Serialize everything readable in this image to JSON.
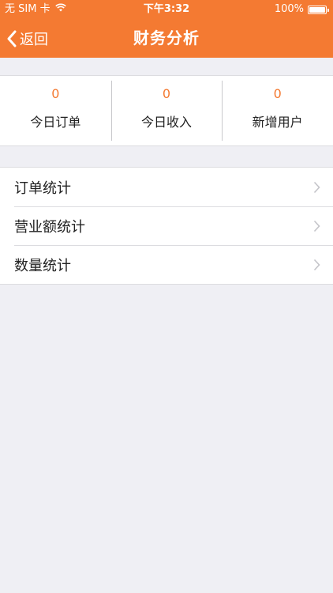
{
  "status_bar": {
    "carrier": "无 SIM 卡",
    "time": "下午3:32",
    "battery": "100%"
  },
  "nav": {
    "back_label": "返回",
    "title": "财务分析"
  },
  "stats": [
    {
      "value": "0",
      "label": "今日订单"
    },
    {
      "value": "0",
      "label": "今日收入"
    },
    {
      "value": "0",
      "label": "新增用户"
    }
  ],
  "menu": [
    {
      "label": "订单统计"
    },
    {
      "label": "营业额统计"
    },
    {
      "label": "数量统计"
    }
  ],
  "colors": {
    "accent": "#f47a32",
    "background": "#efeff4"
  }
}
